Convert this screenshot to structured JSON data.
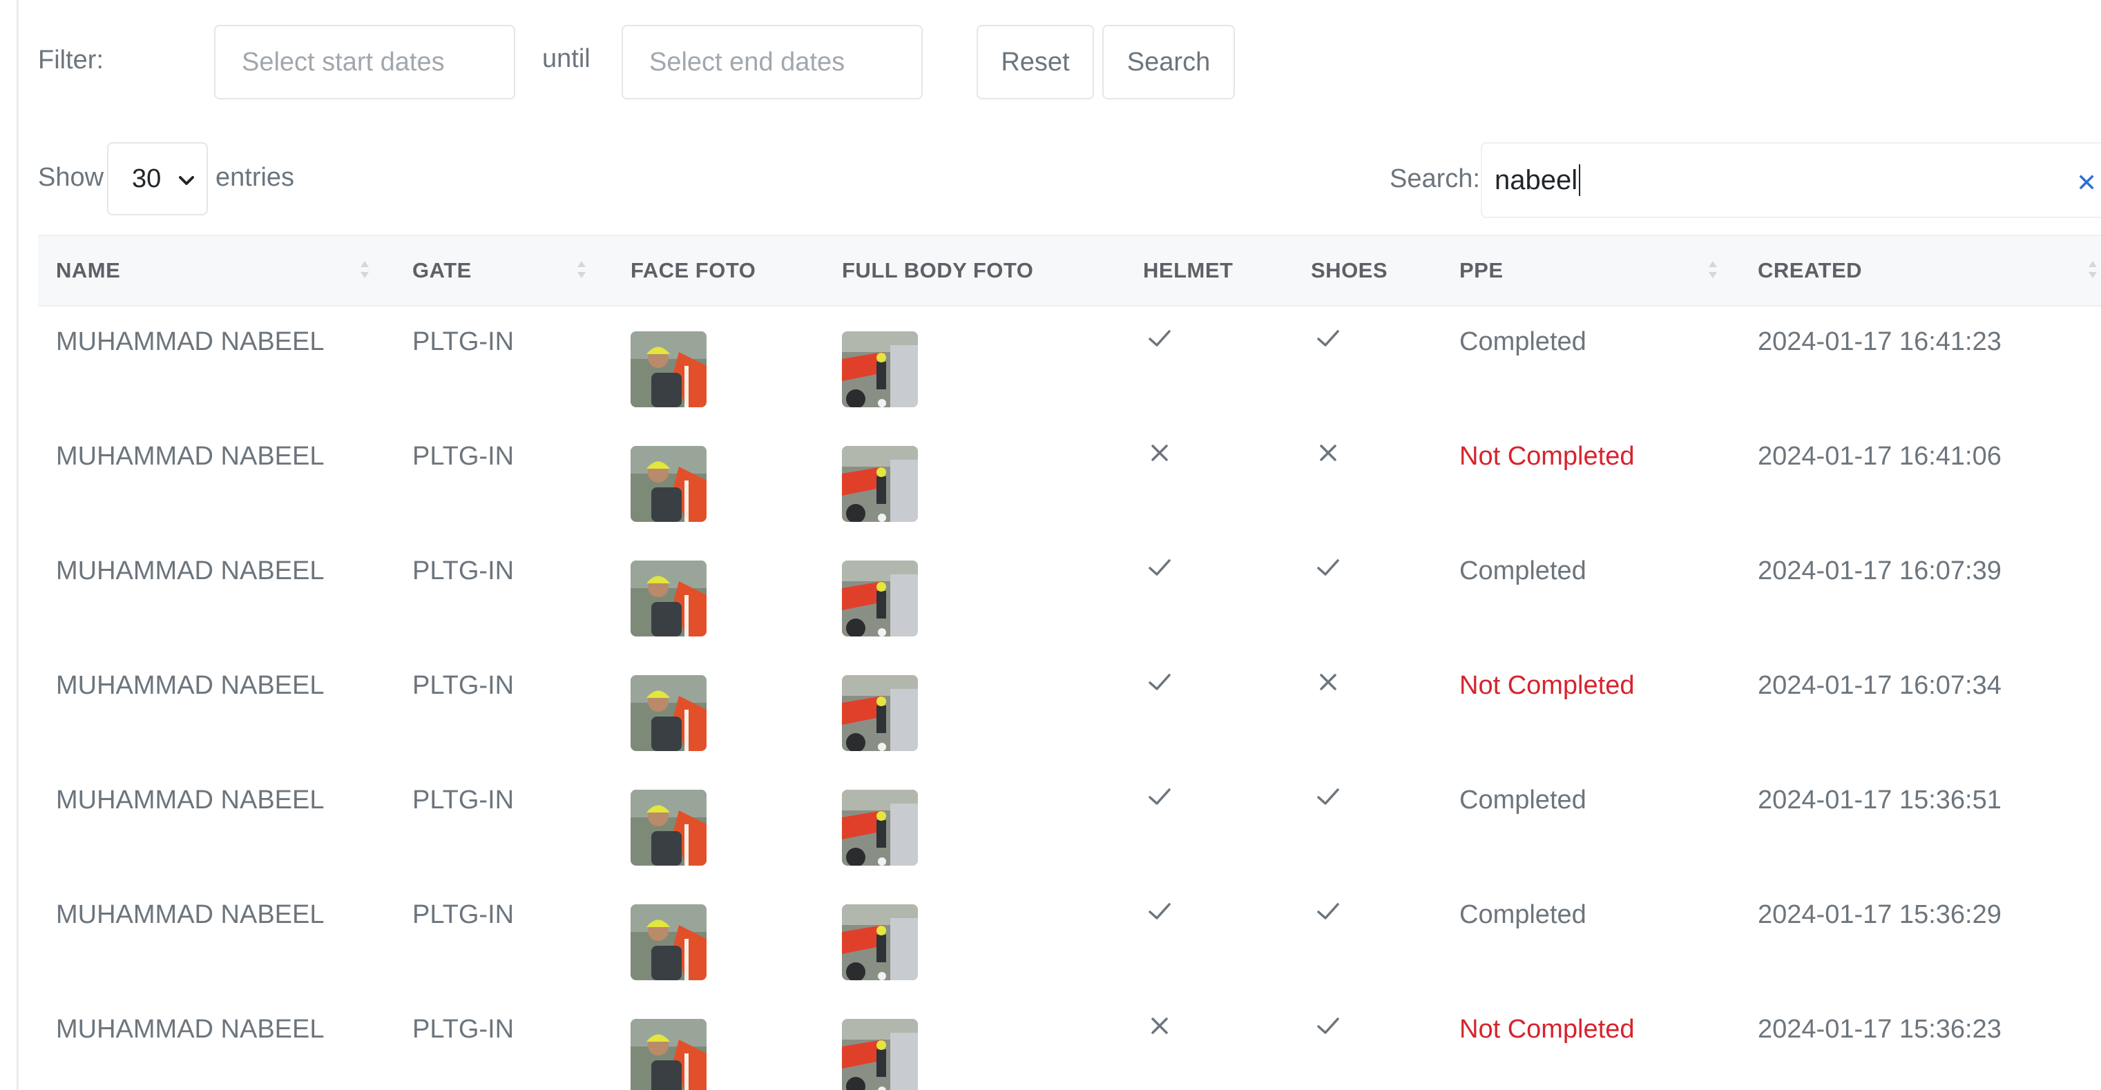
{
  "filter": {
    "label": "Filter:",
    "start_placeholder": "Select start dates",
    "until": "until",
    "end_placeholder": "Select end dates",
    "reset": "Reset",
    "search": "Search"
  },
  "length": {
    "show": "Show",
    "value": "30",
    "entries": "entries"
  },
  "search": {
    "label": "Search:",
    "value": "nabeel",
    "clear_icon": "close-icon"
  },
  "table": {
    "headers": {
      "name": "NAME",
      "gate": "GATE",
      "face": "FACE FOTO",
      "body": "FULL BODY FOTO",
      "helmet": "HELMET",
      "shoes": "SHOES",
      "ppe": "PPE",
      "created": "CREATED"
    },
    "rows": [
      {
        "name": "MUHAMMAD NABEEL",
        "gate": "PLTG-IN",
        "helmet": "check",
        "shoes": "check",
        "ppe": "Completed",
        "created": "2024-01-17 16:41:23"
      },
      {
        "name": "MUHAMMAD NABEEL",
        "gate": "PLTG-IN",
        "helmet": "cross",
        "shoes": "cross",
        "ppe": "Not Completed",
        "created": "2024-01-17 16:41:06"
      },
      {
        "name": "MUHAMMAD NABEEL",
        "gate": "PLTG-IN",
        "helmet": "check",
        "shoes": "check",
        "ppe": "Completed",
        "created": "2024-01-17 16:07:39"
      },
      {
        "name": "MUHAMMAD NABEEL",
        "gate": "PLTG-IN",
        "helmet": "check",
        "shoes": "cross",
        "ppe": "Not Completed",
        "created": "2024-01-17 16:07:34"
      },
      {
        "name": "MUHAMMAD NABEEL",
        "gate": "PLTG-IN",
        "helmet": "check",
        "shoes": "check",
        "ppe": "Completed",
        "created": "2024-01-17 15:36:51"
      },
      {
        "name": "MUHAMMAD NABEEL",
        "gate": "PLTG-IN",
        "helmet": "check",
        "shoes": "check",
        "ppe": "Completed",
        "created": "2024-01-17 15:36:29"
      },
      {
        "name": "MUHAMMAD NABEEL",
        "gate": "PLTG-IN",
        "helmet": "cross",
        "shoes": "check",
        "ppe": "Not Completed",
        "created": "2024-01-17 15:36:23"
      }
    ]
  },
  "colors": {
    "not_completed": "#d6242e",
    "clear_icon": "#2f6fd6"
  }
}
